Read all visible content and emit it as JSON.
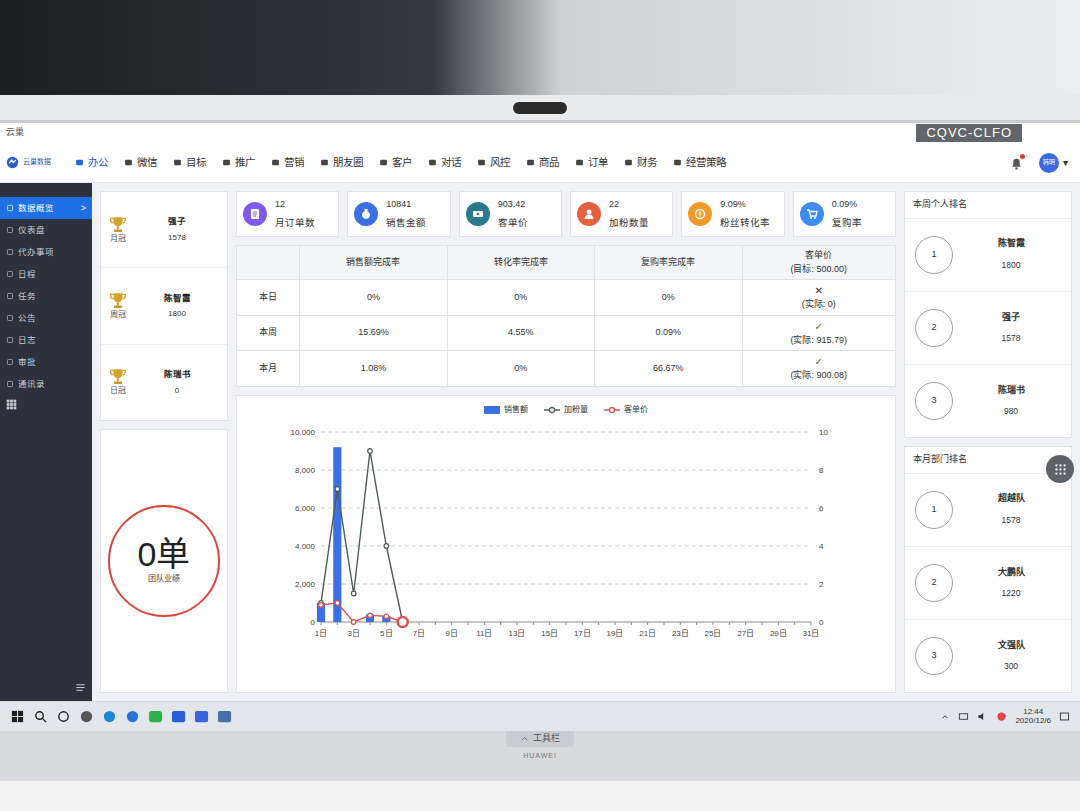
{
  "screen_label": "CQVC-CLFO",
  "app": {
    "title": "云巢",
    "logo": "云巢数据"
  },
  "nav": [
    {
      "label": "办公",
      "selected": true
    },
    {
      "label": "微信",
      "selected": false
    },
    {
      "label": "目标",
      "selected": false
    },
    {
      "label": "推广",
      "selected": false
    },
    {
      "label": "营销",
      "selected": false
    },
    {
      "label": "朋友圈",
      "selected": false
    },
    {
      "label": "客户",
      "selected": false
    },
    {
      "label": "对话",
      "selected": false
    },
    {
      "label": "风控",
      "selected": false
    },
    {
      "label": "商品",
      "selected": false
    },
    {
      "label": "订单",
      "selected": false
    },
    {
      "label": "财务",
      "selected": false
    },
    {
      "label": "经营策略",
      "selected": false
    }
  ],
  "user": {
    "avatar": "韩明",
    "caret": "▾"
  },
  "sidebar": {
    "active_arrow": ">",
    "items": [
      {
        "label": "数据概览",
        "selected": true
      },
      {
        "label": "仪表盘",
        "selected": false
      },
      {
        "label": "代办事项",
        "selected": false
      },
      {
        "label": "日程",
        "selected": false
      },
      {
        "label": "任务",
        "selected": false
      },
      {
        "label": "公告",
        "selected": false
      },
      {
        "label": "日志",
        "selected": false
      },
      {
        "label": "审批",
        "selected": false
      },
      {
        "label": "通讯录",
        "selected": false
      }
    ]
  },
  "champions": [
    {
      "title": "月冠",
      "name": "强子",
      "value": "1578"
    },
    {
      "title": "周冠",
      "name": "陈智霞",
      "value": "1800"
    },
    {
      "title": "日冠",
      "name": "陈瑞书",
      "value": "0"
    }
  ],
  "team": {
    "value": "0单",
    "label": "团队业绩"
  },
  "stats": [
    {
      "value": "12",
      "label": "月订单数",
      "color": "#7c5ce8"
    },
    {
      "value": "10841",
      "label": "销售金额",
      "color": "#3d6fe3"
    },
    {
      "value": "903.42",
      "label": "客单价",
      "color": "#2b7a8c"
    },
    {
      "value": "22",
      "label": "加粉数量",
      "color": "#e4603f"
    },
    {
      "value": "9.09%",
      "label": "粉丝转化率",
      "color": "#f09a2a"
    },
    {
      "value": "0.09%",
      "label": "复购率",
      "color": "#3f8cf0"
    }
  ],
  "table": {
    "columns": [
      "销售额完成率",
      "转化率完成率",
      "复购率完成率"
    ],
    "target_column": {
      "title": "客单价",
      "target": "(目标: 500.00)"
    },
    "rows": [
      {
        "label": "本日",
        "cells": [
          "0%",
          "0%",
          "0%"
        ],
        "met": false,
        "mark": "✕",
        "actual": "(实际: 0)"
      },
      {
        "label": "本周",
        "cells": [
          "15.69%",
          "4.55%",
          "0.09%"
        ],
        "met": true,
        "mark": "✓",
        "actual": "(实际: 915.79)"
      },
      {
        "label": "本月",
        "cells": [
          "1.08%",
          "0%",
          "66.67%"
        ],
        "met": true,
        "mark": "✓",
        "actual": "(实际: 900.08)"
      }
    ]
  },
  "chart": {
    "series": [
      {
        "name": "销售额",
        "kind": "bar",
        "axis": "left",
        "color": "#3b6fe3",
        "values": [
          1000,
          9200,
          0,
          400,
          300,
          0
        ]
      },
      {
        "name": "加粉量",
        "kind": "line",
        "axis": "right",
        "color": "#4d5d5c",
        "values": [
          1,
          7,
          1.5,
          9,
          4,
          0
        ]
      },
      {
        "name": "客单价",
        "kind": "line",
        "axis": "left",
        "color": "#d9534f",
        "values": [
          900,
          1000,
          0,
          350,
          300,
          0
        ]
      }
    ],
    "left_ticks": [
      "0",
      "2,000",
      "4,000",
      "6,000",
      "8,000",
      "10,000"
    ],
    "right_ticks": [
      "0",
      "2",
      "4",
      "6",
      "8",
      "10"
    ],
    "x_labels": [
      "1日",
      "3日",
      "5日",
      "7日",
      "9日",
      "11日",
      "13日",
      "15日",
      "17日",
      "19日",
      "21日",
      "23日",
      "25日",
      "27日",
      "29日",
      "31日"
    ],
    "hover_point": 5
  },
  "weekly": {
    "title": "本周个人排名",
    "items": [
      {
        "rank": "1",
        "name": "陈智霞",
        "value": "1800"
      },
      {
        "rank": "2",
        "name": "强子",
        "value": "1578"
      },
      {
        "rank": "3",
        "name": "陈瑞书",
        "value": "980"
      }
    ]
  },
  "dept": {
    "title": "本月部门排名",
    "items": [
      {
        "rank": "1",
        "name": "超越队",
        "value": "1578"
      },
      {
        "rank": "2",
        "name": "大鹏队",
        "value": "1220"
      },
      {
        "rank": "3",
        "name": "文强队",
        "value": "300"
      }
    ]
  },
  "taskbar": {
    "time": "12:44",
    "date": "2020/12/6"
  },
  "toolbar": {
    "label": "工具栏"
  },
  "brand": "HUAWEI"
}
